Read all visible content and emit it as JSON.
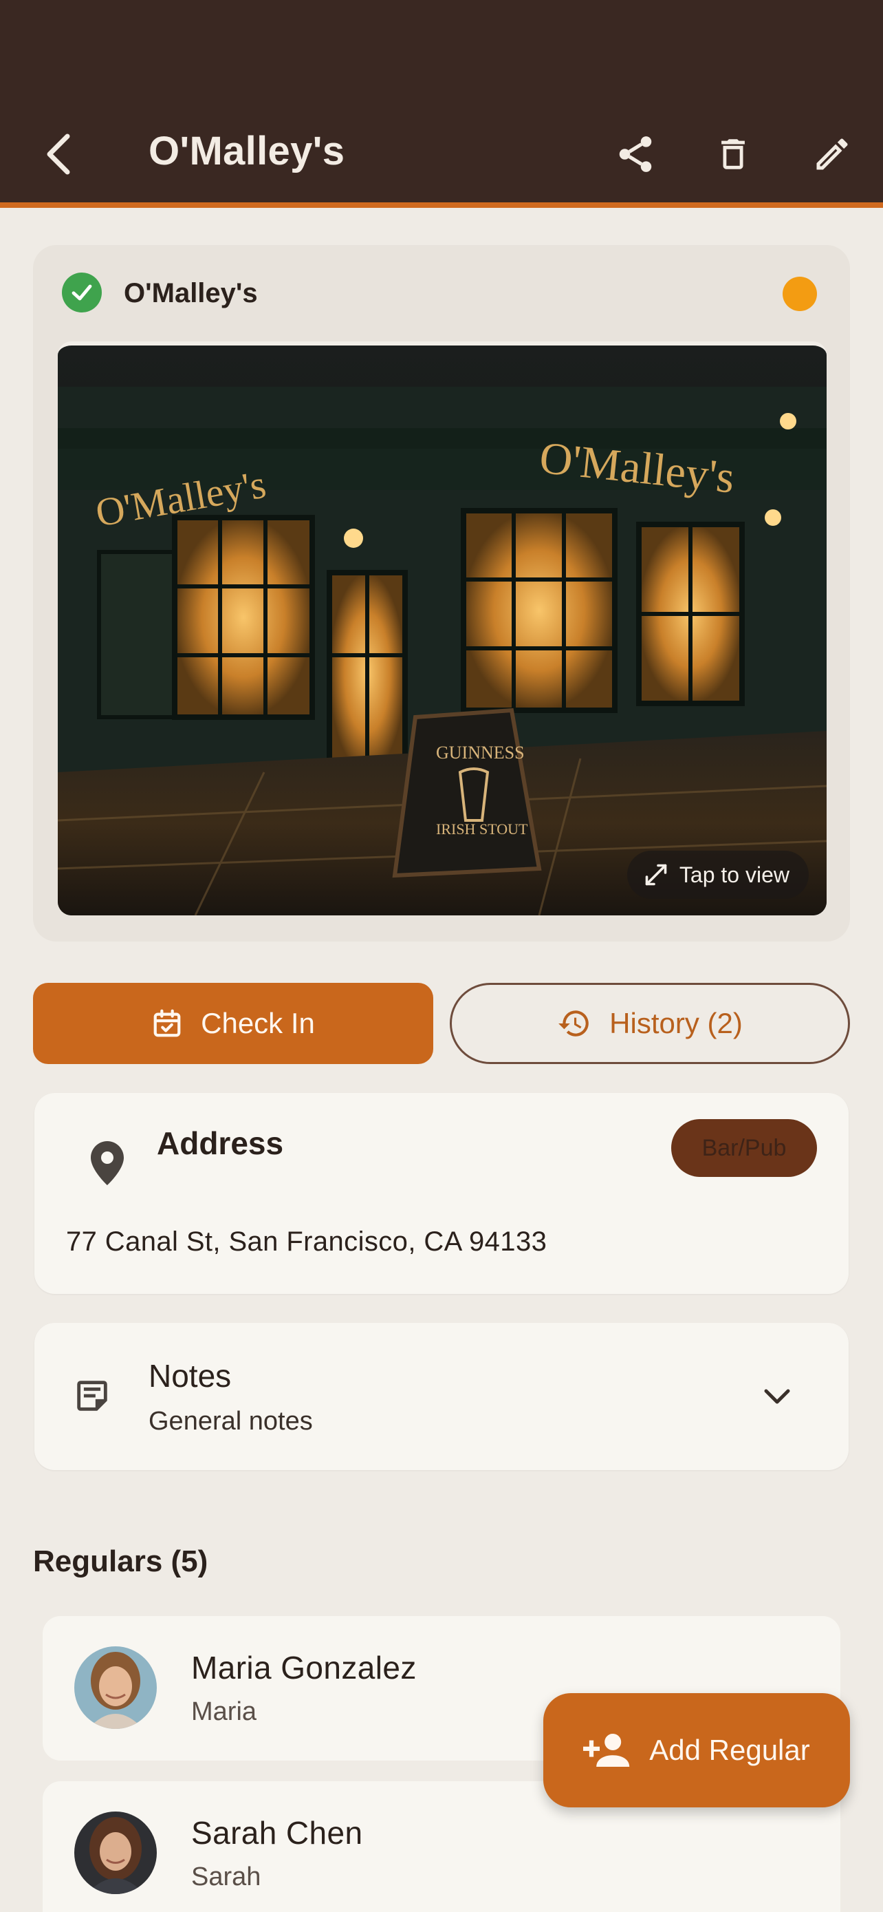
{
  "header": {
    "title": "O'Malley's"
  },
  "place_card": {
    "venue_name": "O'Malley's",
    "photo_sign_text": "O'Malley's",
    "photo_board_lines": [
      "GUINNESS",
      "IRISH STOUT"
    ],
    "tap_to_view": "Tap to view",
    "status_color": "#f39c12"
  },
  "actions": {
    "check_in": "Check In",
    "history": "History (2)"
  },
  "address": {
    "label": "Address",
    "category": "Bar/Pub",
    "value": "77 Canal St, San Francisco, CA 94133"
  },
  "notes": {
    "label": "Notes",
    "subtitle": "General notes"
  },
  "regulars": {
    "title": "Regulars (5)",
    "items": [
      {
        "name": "Maria Gonzalez",
        "nickname": "Maria"
      },
      {
        "name": "Sarah Chen",
        "nickname": "Sarah"
      }
    ]
  },
  "fab": {
    "label": "Add Regular"
  },
  "colors": {
    "appbar": "#3a2822",
    "accent": "#c9671c",
    "success": "#3fa34d",
    "background": "#efebe5"
  }
}
